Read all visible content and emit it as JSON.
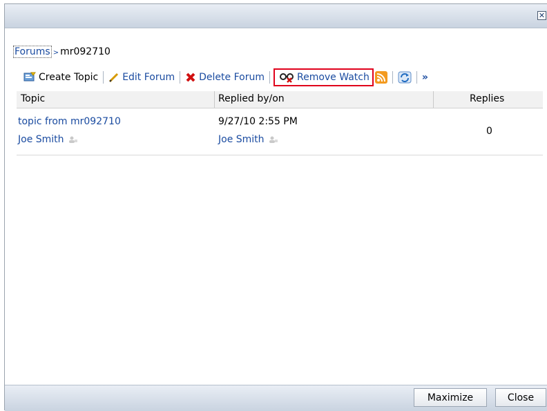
{
  "window": {
    "close_glyph": "✕"
  },
  "breadcrumb": {
    "root": "Forums",
    "separator": ">",
    "current": "mr092710"
  },
  "toolbar": {
    "create_topic": "Create Topic",
    "edit_forum": "Edit Forum",
    "delete_forum": "Delete Forum",
    "remove_watch": "Remove Watch",
    "more": "»"
  },
  "table": {
    "headers": [
      "Topic",
      "Replied by/on",
      "Replies"
    ],
    "rows": [
      {
        "topic": "topic from mr092710",
        "author": "Joe Smith",
        "replied_on": "9/27/10 2:55 PM",
        "replied_by": "Joe Smith",
        "replies": "0"
      }
    ]
  },
  "footer": {
    "maximize": "Maximize",
    "close": "Close"
  },
  "colors": {
    "link": "#1a4ba0",
    "highlight": "#e0001b"
  }
}
